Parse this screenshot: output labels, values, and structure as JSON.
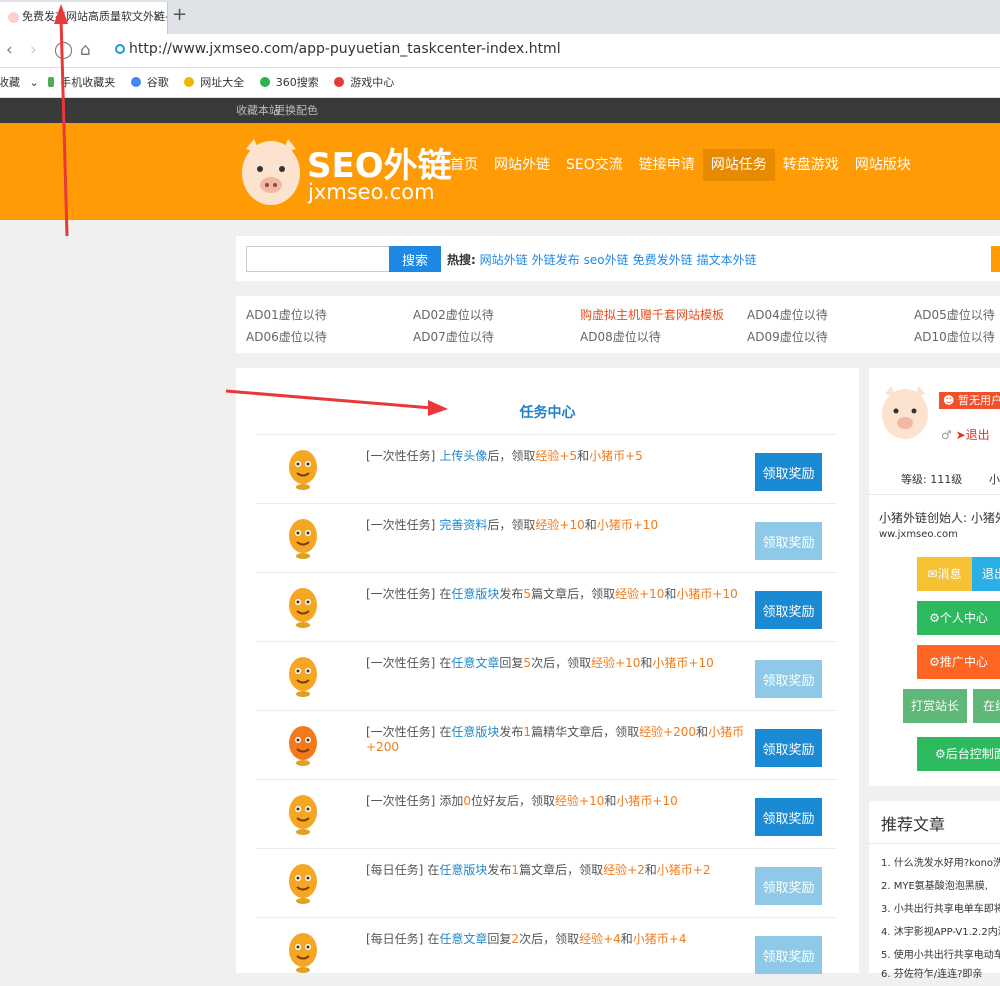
{
  "browser": {
    "tab_title": "免费发布网站高质量软文外链-小",
    "tab_close": "x",
    "new_tab": "+",
    "url": "http://www.jxmseo.com/app-puyuetian_taskcenter-index.html",
    "bookmarks": [
      "收藏",
      "手机收藏夹",
      "谷歌",
      "网址大全",
      "360搜索",
      "游戏中心"
    ]
  },
  "site": {
    "topbar": [
      "收藏本站",
      "更换配色"
    ],
    "logo_title": "SEO外链",
    "logo_sub": "jxmseo.com",
    "nav": [
      "首页",
      "网站外链",
      "SEO交流",
      "链接申请",
      "网站任务",
      "转盘游戏",
      "网站版块"
    ],
    "nav_active_index": 4
  },
  "search": {
    "placeholder": "",
    "button": "搜索",
    "hot_label": "热搜:",
    "hot_links": [
      "网站外链",
      "外链发布",
      "seo外链",
      "免费发外链",
      "描文本外链"
    ]
  },
  "ads": [
    [
      "AD01虚位以待",
      "AD02虚位以待",
      "购虚拟主机赠千套网站模板",
      "AD04虚位以待",
      "AD05虚位以待"
    ],
    [
      "AD06虚位以待",
      "AD07虚位以待",
      "AD08虚位以待",
      "AD09虚位以待",
      "AD10虚位以待"
    ]
  ],
  "task_center": {
    "title": "任务中心",
    "button_label": "领取奖励",
    "tasks": [
      {
        "type": "[一次性任务]",
        "pre": "",
        "link": "上传头像",
        "mid": "后，领取",
        "exp": "经验+5",
        "and": "和",
        "coin": "小猪币+5",
        "dim": false
      },
      {
        "type": "[一次性任务]",
        "pre": "",
        "link": "完善资料",
        "mid": "后，领取",
        "exp": "经验+10",
        "and": "和",
        "coin": "小猪币+10",
        "dim": true
      },
      {
        "type": "[一次性任务]",
        "pre": "在",
        "link": "任意版块",
        "mid": "发布",
        "num": "5",
        "mid2": "篇文章后，领取",
        "exp": "经验+10",
        "and": "和",
        "coin": "小猪币+10",
        "dim": false
      },
      {
        "type": "[一次性任务]",
        "pre": "在",
        "link": "任意文章",
        "mid": "回复",
        "num": "5",
        "mid2": "次后，领取",
        "exp": "经验+10",
        "and": "和",
        "coin": "小猪币+10",
        "dim": true
      },
      {
        "type": "[一次性任务]",
        "pre": "在",
        "link": "任意版块",
        "mid": "发布",
        "num": "1",
        "mid2": "篇精华文章后，领取",
        "exp": "经验+200",
        "and": "和",
        "coin": "小猪币+200",
        "dim": false
      },
      {
        "type": "[一次性任务]",
        "pre": "添加",
        "link": "",
        "mid": "",
        "num": "0",
        "mid2": "位好友后，领取",
        "exp": "经验+10",
        "and": "和",
        "coin": "小猪币+10",
        "dim": false
      },
      {
        "type": "[每日任务]",
        "pre": "在",
        "link": "任意版块",
        "mid": "发布",
        "num": "1",
        "mid2": "篇文章后，领取",
        "exp": "经验+2",
        "and": "和",
        "coin": "小猪币+2",
        "dim": true
      },
      {
        "type": "[每日任务]",
        "pre": "在",
        "link": "任意文章",
        "mid": "回复",
        "num": "2",
        "mid2": "次后，领取",
        "exp": "经验+4",
        "and": "和",
        "coin": "小猪币+4",
        "dim": true
      }
    ]
  },
  "user_panel": {
    "group_badge": "暂无用户组",
    "gender_symbol": "♂",
    "logout_link": "退出",
    "level": "等级: 111级",
    "level_extra": "小",
    "founder": "小猪外链创始人: 小猪外链",
    "founder_url": "ww.jxmseo.com",
    "buttons": {
      "messages": "消息",
      "logout": "退出",
      "personal_center": "个人中心",
      "promo_center": "推广中心",
      "tip": "打赏站长",
      "online": "在线",
      "admin": "后台控制面板"
    }
  },
  "recommend": {
    "title": "推荐文章",
    "items": [
      "1. 什么洗发水好用?kono洗",
      "2. MYE氨基酸泡泡黑膜,",
      "3. 小共出行共享电单车即将",
      "4. 沐宇影视APP-V1.2.2内测",
      "5. 使用小共出行共享电动车",
      "6. 芬佐符乍/连连?即亲"
    ]
  },
  "colors": {
    "orange": "#ff9b05",
    "blue": "#1a8ad4",
    "green": "#2dba5e",
    "red_orange": "#ff6422"
  }
}
